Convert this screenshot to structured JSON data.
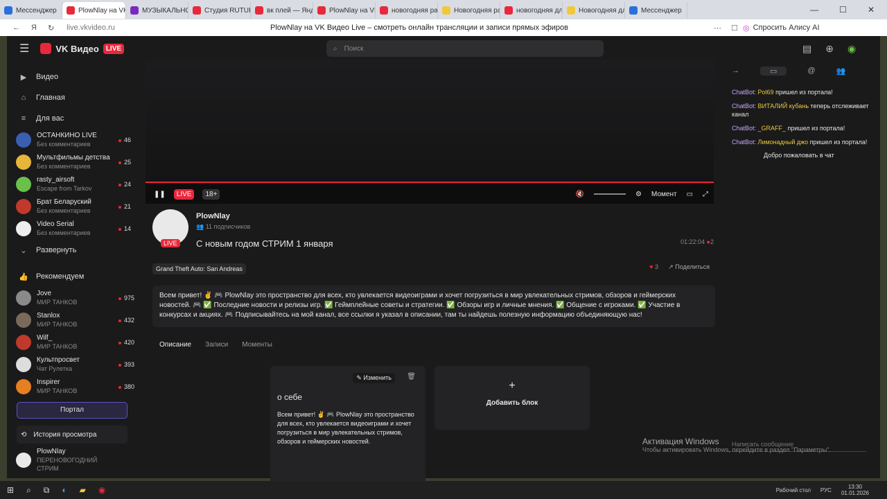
{
  "tabs": [
    {
      "label": "Мессенджер",
      "color": "#2a6fdb"
    },
    {
      "label": "PlowNlay на VK",
      "color": "#e8293b",
      "active": true
    },
    {
      "label": "МУЗЫКАЛЬНО",
      "color": "#7a2bbf"
    },
    {
      "label": "Студия RUTUB",
      "color": "#e8293b"
    },
    {
      "label": "вк плей — Янд",
      "color": "#e8293b"
    },
    {
      "label": "PlowNlay на VK",
      "color": "#e8293b"
    },
    {
      "label": "новогодняя ра",
      "color": "#e8293b"
    },
    {
      "label": "Новогодняя ра",
      "color": "#f0c93a"
    },
    {
      "label": "новогодняя дл",
      "color": "#e8293b"
    },
    {
      "label": "Новогодняя дл",
      "color": "#f0c93a"
    },
    {
      "label": "Мессенджер",
      "color": "#2a6fdb"
    }
  ],
  "browser": {
    "url": "live.vkvideo.ru",
    "title": "PlowNlay на VK Видео Live – смотреть онлайн трансляции и записи прямых эфиров",
    "alice": "Спросить Алису AI"
  },
  "header": {
    "logo": "VK Видео",
    "live": "LIVE",
    "search_placeholder": "Поиск"
  },
  "sidebar": {
    "nav": [
      {
        "label": "Видео",
        "icon": "play-icon"
      },
      {
        "label": "Главная",
        "icon": "home-icon"
      },
      {
        "label": "Для вас",
        "icon": "foryou-icon"
      }
    ],
    "channels": [
      {
        "name": "ОСТАНКИНО LIVE",
        "sub": "Без комментариев",
        "count": "46",
        "color": "#3a5fb0"
      },
      {
        "name": "Мультфильмы детства",
        "sub": "Без комментариев",
        "count": "25",
        "color": "#e6b53a"
      },
      {
        "name": "rasty_airsoft",
        "sub": "Escape from Tarkov",
        "count": "24",
        "color": "#6ac04a"
      },
      {
        "name": "Брат Беларуский",
        "sub": "Без комментариев",
        "count": "21",
        "color": "#c0392b"
      },
      {
        "name": "Video Serial",
        "sub": "Без комментариев",
        "count": "14",
        "color": "#eee"
      }
    ],
    "expand": "Развернуть",
    "recommended_title": "Рекомендуем",
    "recommended": [
      {
        "name": "Jove",
        "sub": "МИР ТАНКОВ",
        "count": "975",
        "color": "#8a8a8a"
      },
      {
        "name": "Stanlox",
        "sub": "МИР ТАНКОВ",
        "count": "432",
        "color": "#7a6a5a"
      },
      {
        "name": "Wilf_",
        "sub": "МИР ТАНКОВ",
        "count": "420",
        "color": "#c0392b"
      },
      {
        "name": "Культпросвет",
        "sub": "Чат Рулетка",
        "count": "393",
        "color": "#ddd"
      },
      {
        "name": "Inspirer",
        "sub": "МИР ТАНКОВ",
        "count": "380",
        "color": "#e67e22"
      }
    ],
    "portal": "Портал",
    "history": "История просмотра",
    "bottom_channel": "PlowNlay",
    "bottom_sub": "ПЕРЕНОВОГОДНИЙ СТРИМ"
  },
  "player": {
    "live": "LIVE",
    "age": "18+",
    "moment": "Момент"
  },
  "stream": {
    "channel": "PlowNlay",
    "subs": "11 подписчиков",
    "title": "С новым годом СТРИМ 1 января",
    "time": "01:22:04",
    "viewers": "2",
    "game": "Grand Theft Auto: San Andreas",
    "likes": "3",
    "share": "Поделиться",
    "description": "Всем привет! ✌ 🎮 PlowNlay это пространство для всех, кто увлекается видеоиграми и хочет погрузиться в мир увлекательных стримов, обзоров и геймерских новостей. 🎮 ✅ Последние новости и релизы игр. ✅ Геймплейные советы и стратегии. ✅ Обзоры игр и личные мнения. ✅ Общение с игроками. ✅ Участие в конкурсах и акциях. 🎮 Подписывайтесь на мой канал, все ссылки я указал в описании, там ты найдешь полезную информацию объединяющую нас!"
  },
  "page_tabs": [
    "Описание",
    "Записи",
    "Моменты"
  ],
  "about": {
    "edit": "Изменить",
    "title": "о себе",
    "text": "Всем привет! ✌ 🎮 PlowNlay это пространство для всех, кто увлекается видеоиграми и хочет погрузиться в мир увлекательных стримов, обзоров и геймерских новостей."
  },
  "add_block": "Добавить блок",
  "chat": {
    "messages": [
      {
        "bot": "ChatBot:",
        "nick": "Pol69",
        "text": "пришел из портала!"
      },
      {
        "bot": "ChatBot:",
        "nick": "ВИТАЛИЙ кубань",
        "text": "теперь отслеживает канал"
      },
      {
        "bot": "ChatBot:",
        "nick": "_GRAFF_",
        "text": "пришел из портала!"
      },
      {
        "bot": "ChatBot:",
        "nick": "Лимонадный джо",
        "text": "пришел из портала!"
      }
    ],
    "welcome": "Добро пожаловать в чат",
    "input_placeholder": "Написать сообщение"
  },
  "watermark": {
    "title": "Активация Windows",
    "sub": "Чтобы активировать Windows, перейдите в раздел \"Параметры\"."
  },
  "taskbar": {
    "desktop": "Рабочий стол",
    "lang": "РУС",
    "time": "13:30",
    "date": "01.01.2026"
  }
}
